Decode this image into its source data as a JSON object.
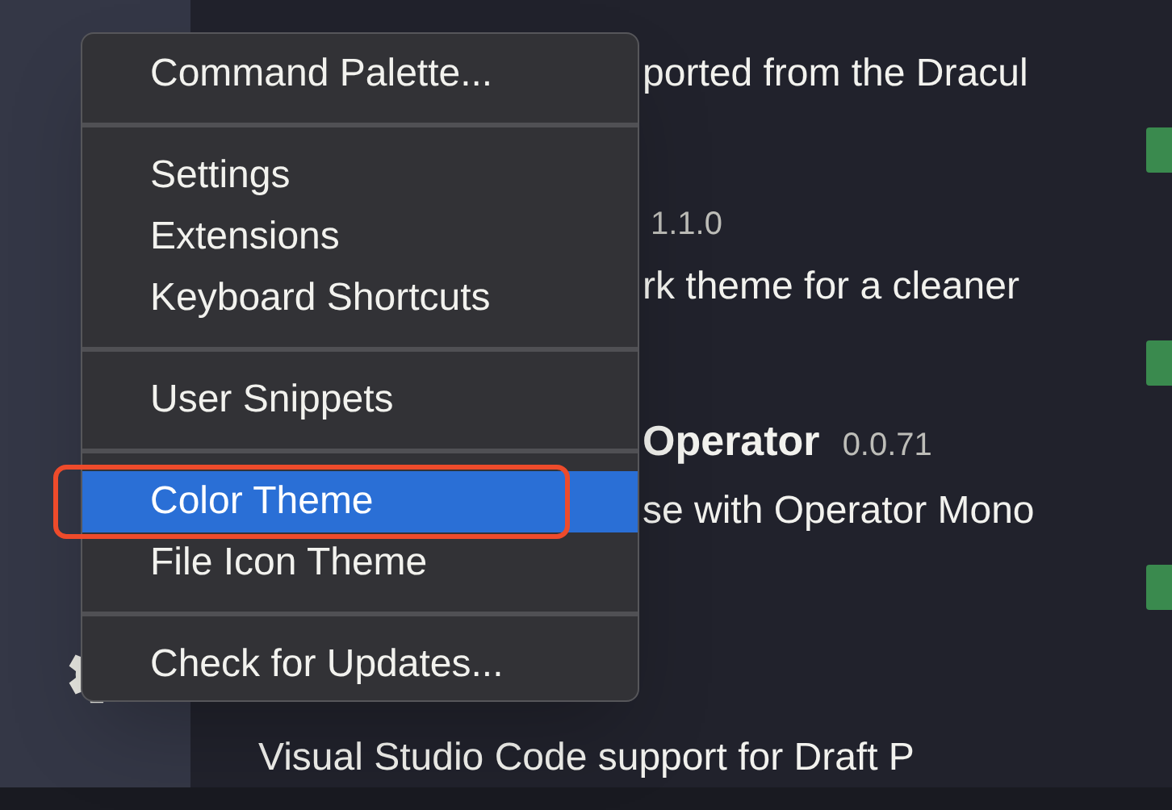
{
  "extensions": [
    {
      "kind": "description",
      "text": "ported from the Dracul"
    },
    {
      "kind": "install"
    },
    {
      "kind": "version",
      "text": "1.1.0"
    },
    {
      "kind": "description",
      "text": "rk theme for a cleaner"
    },
    {
      "kind": "install"
    },
    {
      "kind": "title",
      "name": "Operator",
      "version": "0.0.71"
    },
    {
      "kind": "description",
      "text": "se with Operator Mono"
    },
    {
      "kind": "install"
    },
    {
      "kind": "spacer"
    },
    {
      "kind": "description",
      "text": "Visual Studio Code support for Draft P"
    }
  ],
  "menu": [
    {
      "kind": "item",
      "label": "Command Palette...",
      "selected": false,
      "highlighted": false
    },
    {
      "kind": "separator"
    },
    {
      "kind": "item",
      "label": "Settings",
      "selected": false,
      "highlighted": false
    },
    {
      "kind": "item",
      "label": "Extensions",
      "selected": false,
      "highlighted": false
    },
    {
      "kind": "item",
      "label": "Keyboard Shortcuts",
      "selected": false,
      "highlighted": false
    },
    {
      "kind": "separator"
    },
    {
      "kind": "item",
      "label": "User Snippets",
      "selected": false,
      "highlighted": false
    },
    {
      "kind": "separator"
    },
    {
      "kind": "item",
      "label": "Color Theme",
      "selected": true,
      "highlighted": true
    },
    {
      "kind": "item",
      "label": "File Icon Theme",
      "selected": false,
      "highlighted": false
    },
    {
      "kind": "separator"
    },
    {
      "kind": "item",
      "label": "Check for Updates...",
      "selected": false,
      "highlighted": false
    }
  ]
}
